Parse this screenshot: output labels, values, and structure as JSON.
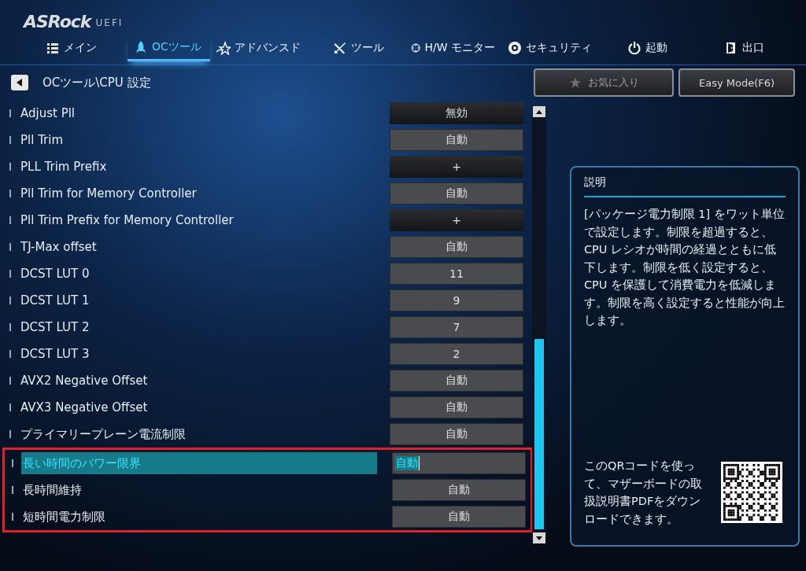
{
  "logo": {
    "brand": "ASRock",
    "suffix": "UEFI"
  },
  "tabs": [
    {
      "label": "メイン",
      "selected": false
    },
    {
      "label": "OCツール",
      "selected": true
    },
    {
      "label": "アドバンスド",
      "selected": false
    },
    {
      "label": "ツール",
      "selected": false
    },
    {
      "label": "H/W モニター",
      "selected": false
    },
    {
      "label": "セキュリティ",
      "selected": false
    },
    {
      "label": "起動",
      "selected": false
    },
    {
      "label": "出口",
      "selected": false
    }
  ],
  "breadcrumb": "OCツール\\CPU 設定",
  "favorites_button": "お気に入り",
  "easy_mode_button": "Easy Mode(F6)",
  "rows": [
    {
      "label": "Adjust Pll",
      "value": "無効",
      "kind": "select",
      "selected": false,
      "outlined": false
    },
    {
      "label": "Pll Trim",
      "value": "自動",
      "kind": "field",
      "selected": false,
      "outlined": false
    },
    {
      "label": "PLL Trim Prefix",
      "value": "+",
      "kind": "select",
      "selected": false,
      "outlined": false
    },
    {
      "label": "Pll Trim for Memory Controller",
      "value": "自動",
      "kind": "field",
      "selected": false,
      "outlined": false
    },
    {
      "label": "Pll Trim Prefix for Memory Controller",
      "value": "+",
      "kind": "select",
      "selected": false,
      "outlined": false
    },
    {
      "label": "TJ-Max offset",
      "value": "自動",
      "kind": "field",
      "selected": false,
      "outlined": false
    },
    {
      "label": "DCST LUT 0",
      "value": "11",
      "kind": "field",
      "selected": false,
      "outlined": false
    },
    {
      "label": "DCST LUT 1",
      "value": "9",
      "kind": "field",
      "selected": false,
      "outlined": false
    },
    {
      "label": "DCST LUT 2",
      "value": "7",
      "kind": "field",
      "selected": false,
      "outlined": false
    },
    {
      "label": "DCST LUT 3",
      "value": "2",
      "kind": "field",
      "selected": false,
      "outlined": false
    },
    {
      "label": "AVX2 Negative Offset",
      "value": "自動",
      "kind": "field",
      "selected": false,
      "outlined": false
    },
    {
      "label": "AVX3 Negative Offset",
      "value": "自動",
      "kind": "field",
      "selected": false,
      "outlined": false
    },
    {
      "label": "プライマリープレーン電流制限",
      "value": "自動",
      "kind": "field",
      "selected": false,
      "outlined": false
    },
    {
      "label": "長い時間のパワー限界",
      "value": "自動",
      "kind": "field",
      "selected": true,
      "outlined": true
    },
    {
      "label": "長時間維持",
      "value": "自動",
      "kind": "field",
      "selected": false,
      "outlined": true
    },
    {
      "label": "短時間電力制限",
      "value": "自動",
      "kind": "field",
      "selected": false,
      "outlined": true
    }
  ],
  "help": {
    "title": "説明",
    "text": "[パッケージ電力制限 1] をワット単位で設定します。制限を超過すると、CPU レシオが時間の経過とともに低下します。制限を低く設定すると、CPU を保護して消費電力を低減します。制限を高く設定すると性能が向上します。",
    "qr_text": "このQRコードを使って、マザーボードの取扱説明書PDFをダウンロードできます。"
  }
}
